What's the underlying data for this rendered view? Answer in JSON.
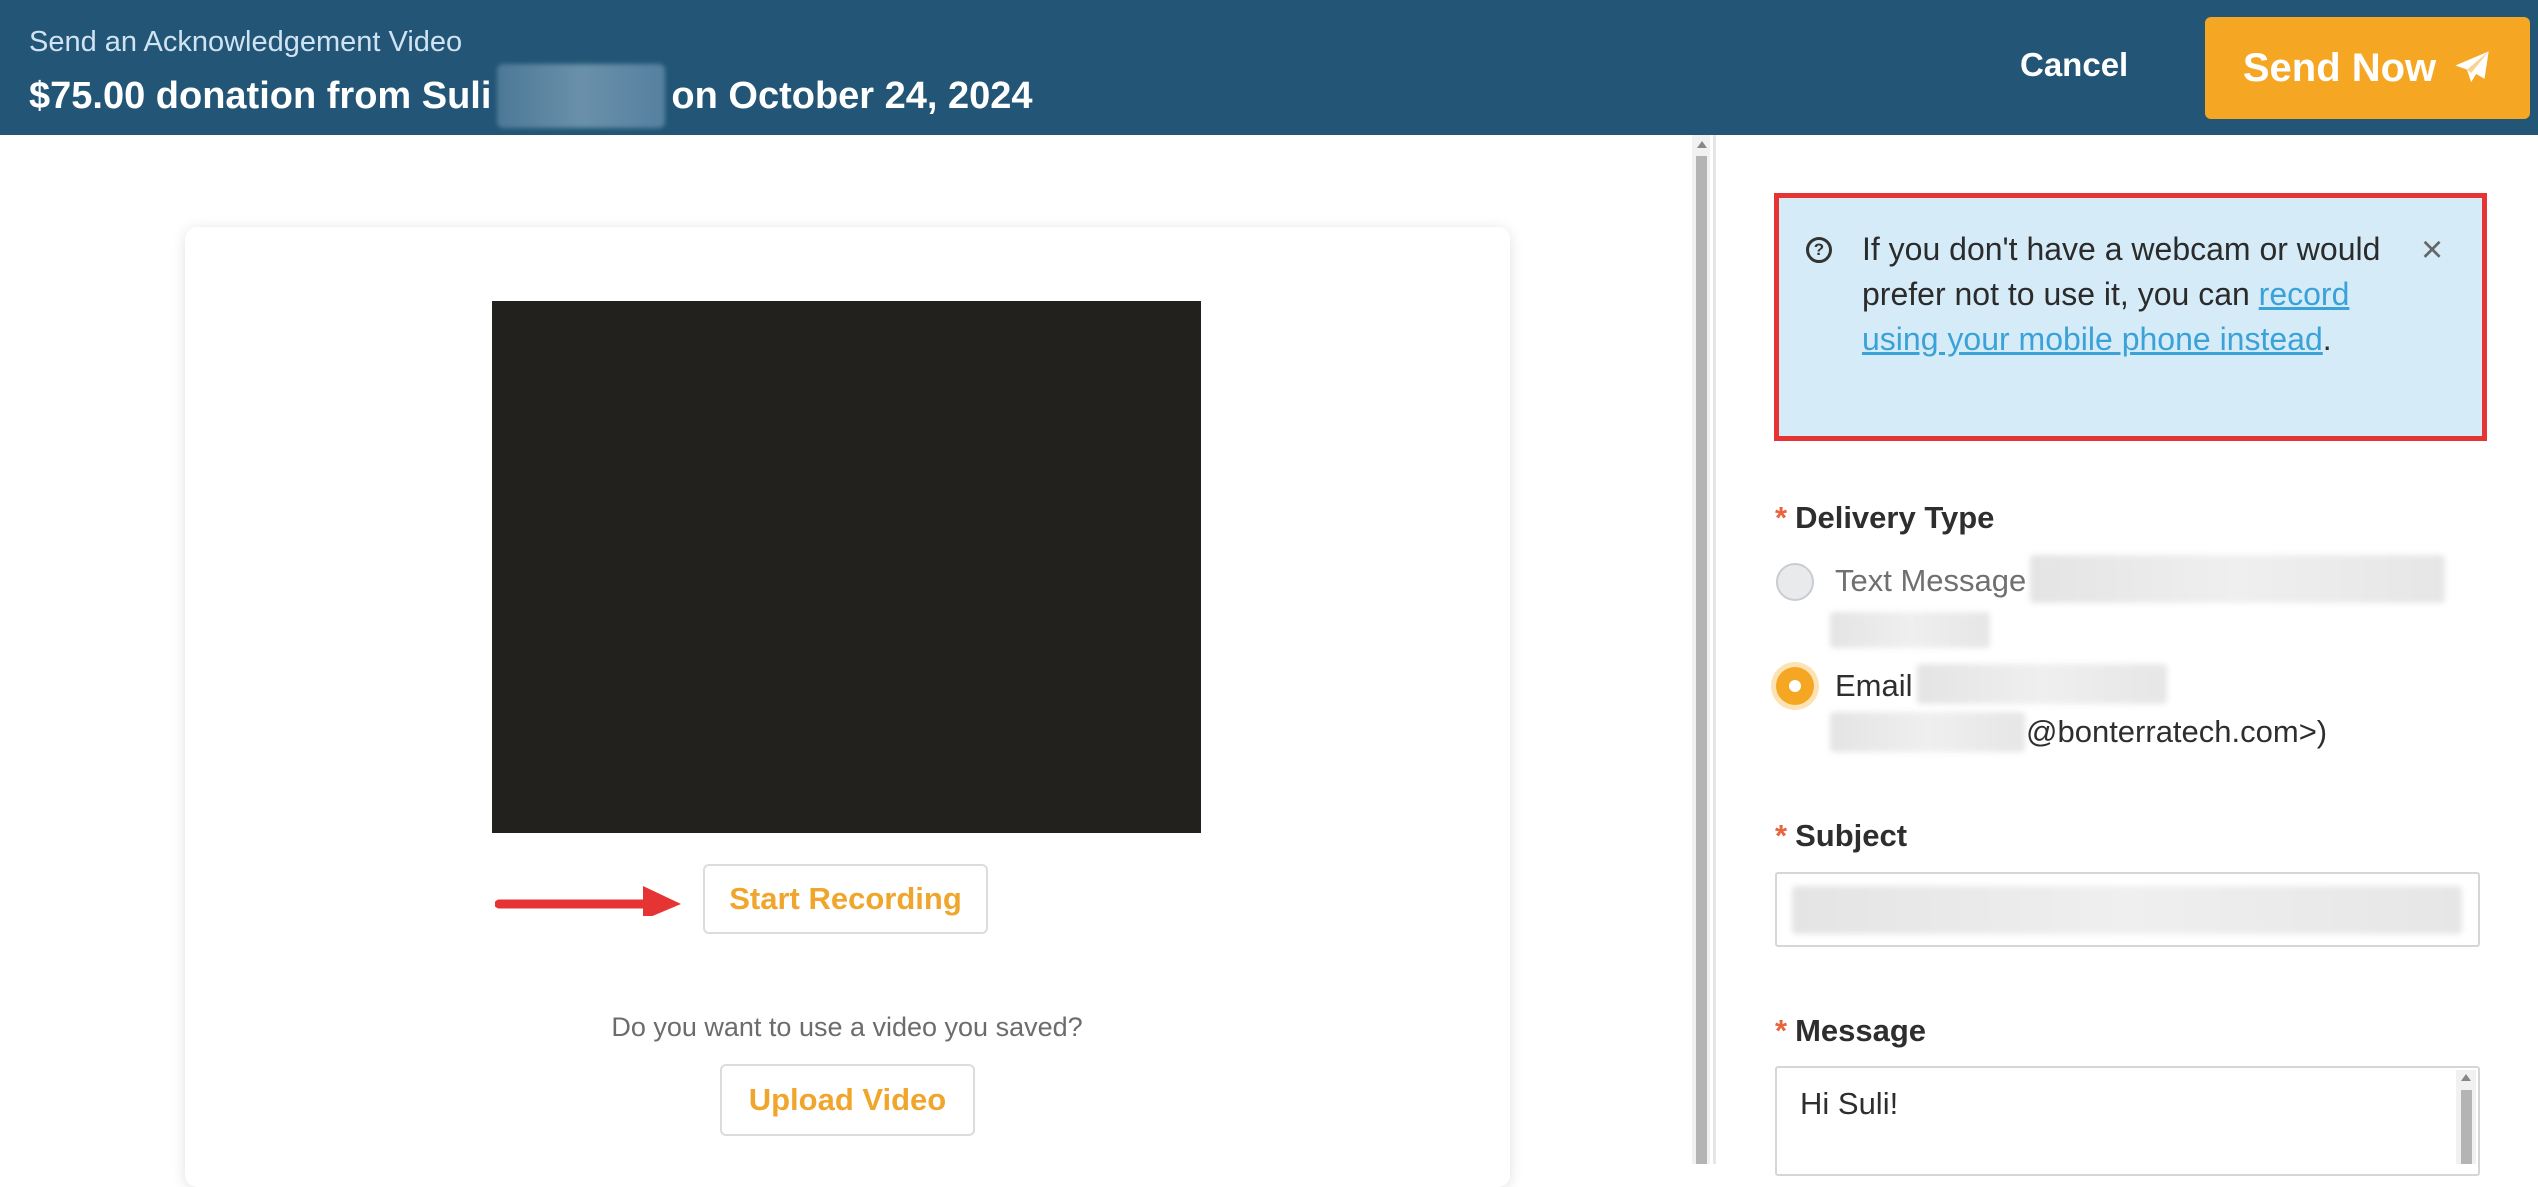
{
  "header": {
    "subtitle": "Send an Acknowledgement Video",
    "title_prefix": "$75.00 donation from Suli",
    "title_suffix": "on October 24, 2024",
    "cancel_label": "Cancel",
    "send_label": "Send Now",
    "send_icon": "paper-plane-icon"
  },
  "recorder": {
    "start_label": "Start Recording",
    "saved_question": "Do you want to use a video you saved?",
    "upload_label": "Upload Video"
  },
  "info": {
    "text_before": "If you don't have a webcam or would prefer not to use it, you can ",
    "link_text": "record using your mobile phone instead",
    "text_after": ".",
    "help_icon": "question-circle-icon",
    "close_icon": "close-icon"
  },
  "form": {
    "delivery_label": "Delivery Type",
    "options": [
      {
        "label": "Text Message",
        "selected": false
      },
      {
        "label": "Email",
        "selected": true,
        "detail_suffix": "@bonterratech.com>)"
      }
    ],
    "subject_label": "Subject",
    "message_label": "Message",
    "message_value": "Hi Suli!",
    "required_mark": "*"
  },
  "colors": {
    "header_bg": "#235676",
    "accent": "#f5a623",
    "info_bg": "#d5ecf8",
    "highlight_border": "#e63434",
    "link": "#3ba2d8"
  }
}
